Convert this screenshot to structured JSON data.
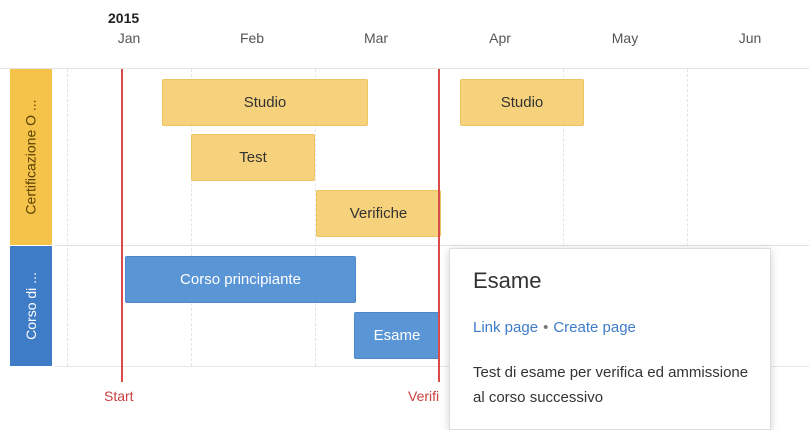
{
  "timeline": {
    "year": "2015",
    "months": [
      "Jan",
      "Feb",
      "Mar",
      "Apr",
      "May",
      "Jun"
    ]
  },
  "lanes": {
    "certificazione": "Certificazione O ...",
    "corso": "Corso di ..."
  },
  "bars": [
    {
      "label": "Studio",
      "lane": "certificazione",
      "color": "#f7d27c"
    },
    {
      "label": "Studio",
      "lane": "certificazione",
      "color": "#f7d27c"
    },
    {
      "label": "Test",
      "lane": "certificazione",
      "color": "#f7d27c"
    },
    {
      "label": "Verifiche",
      "lane": "certificazione",
      "color": "#f7d27c"
    },
    {
      "label": "Corso principiante",
      "lane": "corso",
      "color": "#5a95d6"
    },
    {
      "label": "Esame",
      "lane": "corso",
      "color": "#5a95d6"
    }
  ],
  "markers": [
    {
      "label": "Start",
      "color": "#d94a4a"
    },
    {
      "label": "Verifi",
      "color": "#d94a4a"
    }
  ],
  "popup": {
    "title": "Esame",
    "link_page": "Link page",
    "separator": "•",
    "create_page": "Create page",
    "description": "Test di esame per verifica ed ammissione al corso successivo"
  }
}
